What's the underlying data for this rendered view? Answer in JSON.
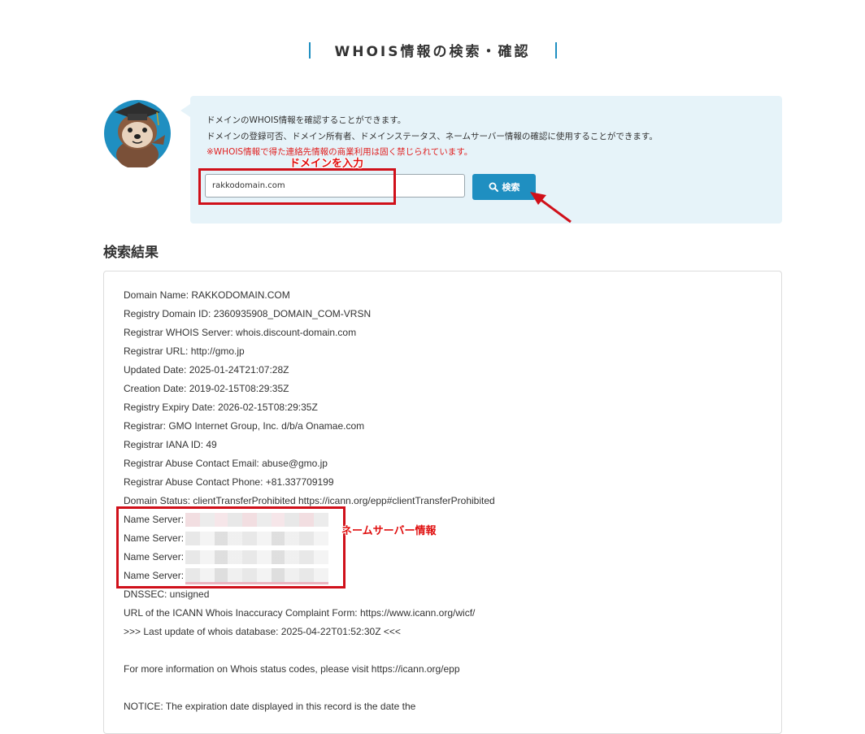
{
  "page": {
    "title": "WHOIS情報の検索・確認"
  },
  "info": {
    "line1": "ドメインのWHOIS情報を確認することができます。",
    "line2": "ドメインの登録可否、ドメイン所有者、ドメインステータス、ネームサーバー情報の確認に使用することができます。",
    "warning": "※WHOIS情報で得た連絡先情報の商業利用は固く禁じられています。"
  },
  "search": {
    "value": "rakkodomain.com",
    "button_label": "検索",
    "button_icon": "search-icon"
  },
  "annotations": {
    "input_label": "ドメインを入力",
    "nameserver_label": "ネームサーバー情報",
    "color": "#e01010"
  },
  "results": {
    "heading": "検索結果",
    "lines": [
      "Domain Name: RAKKODOMAIN.COM",
      "Registry Domain ID: 2360935908_DOMAIN_COM-VRSN",
      "Registrar WHOIS Server: whois.discount-domain.com",
      "Registrar URL: http://gmo.jp",
      "Updated Date: 2025-01-24T21:07:28Z",
      "Creation Date: 2019-02-15T08:29:35Z",
      "Registry Expiry Date: 2026-02-15T08:29:35Z",
      "Registrar: GMO Internet Group, Inc. d/b/a Onamae.com",
      "Registrar IANA ID: 49",
      "Registrar Abuse Contact Email: abuse@gmo.jp",
      "Registrar Abuse Contact Phone: +81.337709199",
      "Domain Status: clientTransferProhibited https://icann.org/epp#clientTransferProhibited"
    ],
    "name_server_label": "Name Server:",
    "lines_after": [
      "DNSSEC: unsigned",
      "URL of the ICANN Whois Inaccuracy Complaint Form: https://www.icann.org/wicf/",
      ">>> Last update of whois database: 2025-04-22T01:52:30Z <<<"
    ],
    "more_info": "For more information on Whois status codes, please visit https://icann.org/epp",
    "notice": "NOTICE: The expiration date displayed in this record is the date the"
  },
  "colors": {
    "accent": "#1f8fc1",
    "info_bg": "#e6f3f9",
    "warning": "#e02020"
  }
}
